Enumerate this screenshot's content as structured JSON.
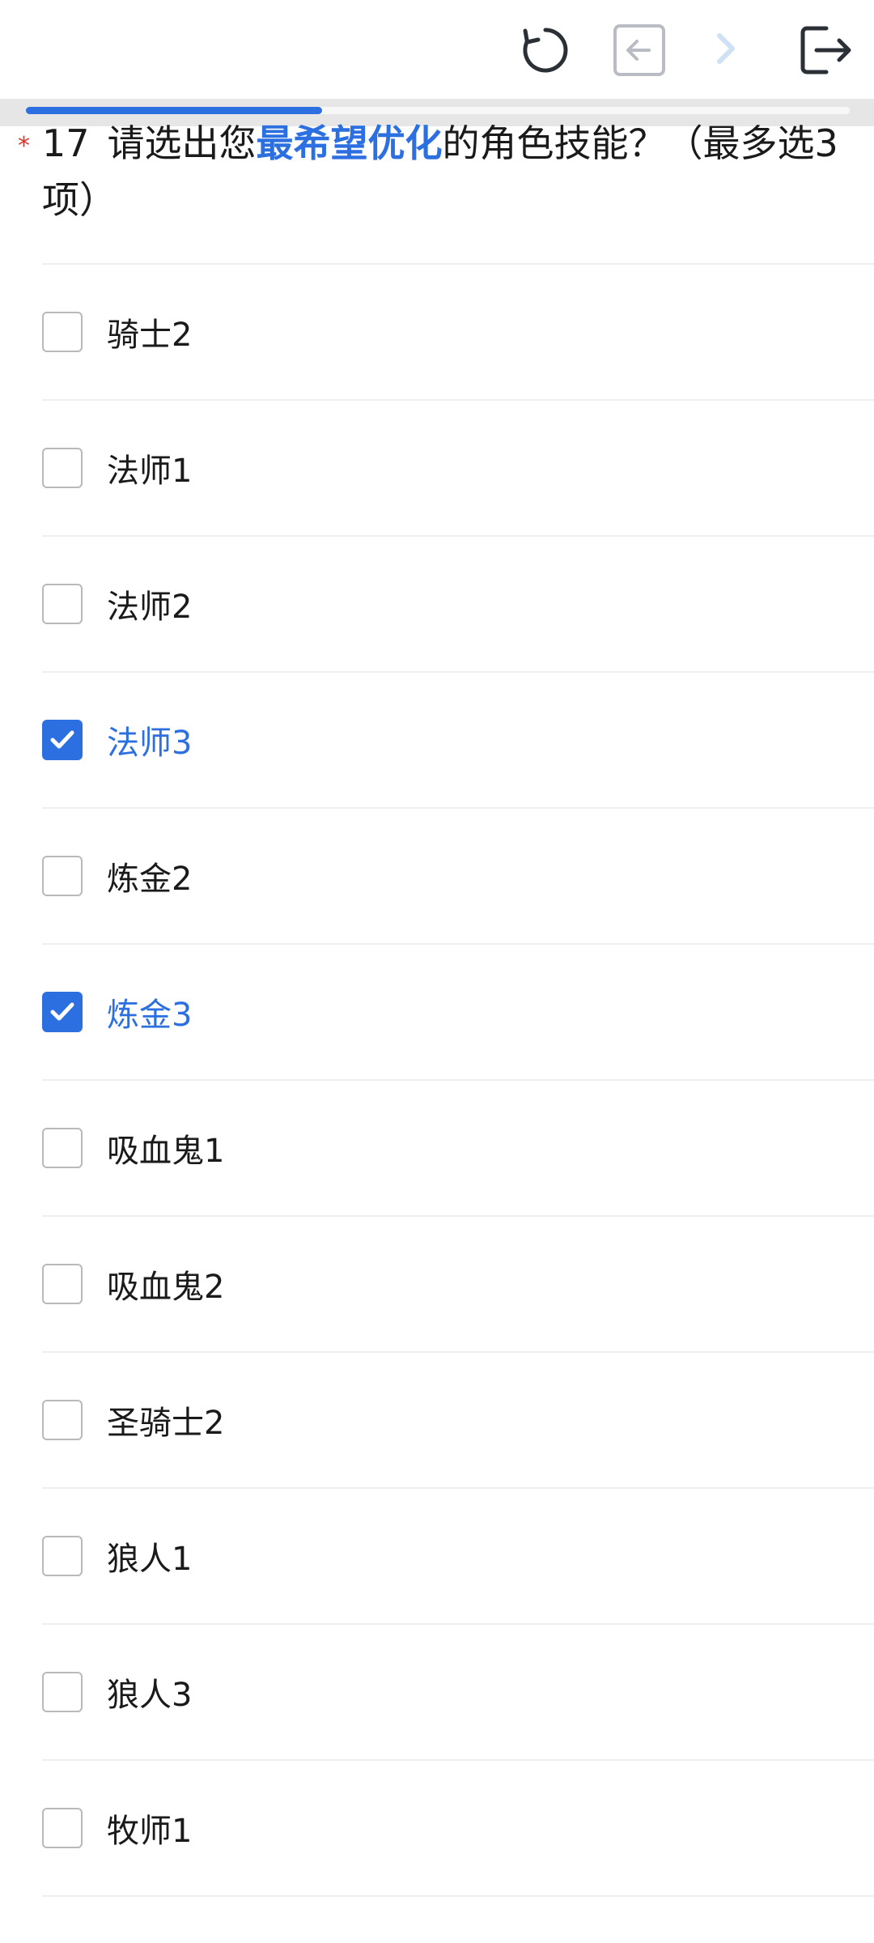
{
  "toolbar": {
    "refresh_icon": "refresh-icon",
    "prev_icon": "arrow-left-box-icon",
    "next_icon": "chevron-right-icon",
    "exit_icon": "logout-icon"
  },
  "progress": {
    "fraction": 0.36
  },
  "question": {
    "required_mark": "*",
    "number": "17",
    "text_before": "请选出您",
    "text_highlight": "最希望优化",
    "text_after": "的角色技能？（最多选3项）"
  },
  "options": [
    {
      "label": "骑士2",
      "checked": false
    },
    {
      "label": "法师1",
      "checked": false
    },
    {
      "label": "法师2",
      "checked": false
    },
    {
      "label": "法师3",
      "checked": true
    },
    {
      "label": "炼金2",
      "checked": false
    },
    {
      "label": "炼金3",
      "checked": true
    },
    {
      "label": "吸血鬼1",
      "checked": false
    },
    {
      "label": "吸血鬼2",
      "checked": false
    },
    {
      "label": "圣骑士2",
      "checked": false
    },
    {
      "label": "狼人1",
      "checked": false
    },
    {
      "label": "狼人3",
      "checked": false
    },
    {
      "label": "牧师1",
      "checked": false
    }
  ],
  "colors": {
    "accent": "#2c6fe0",
    "required": "#e0322b"
  }
}
